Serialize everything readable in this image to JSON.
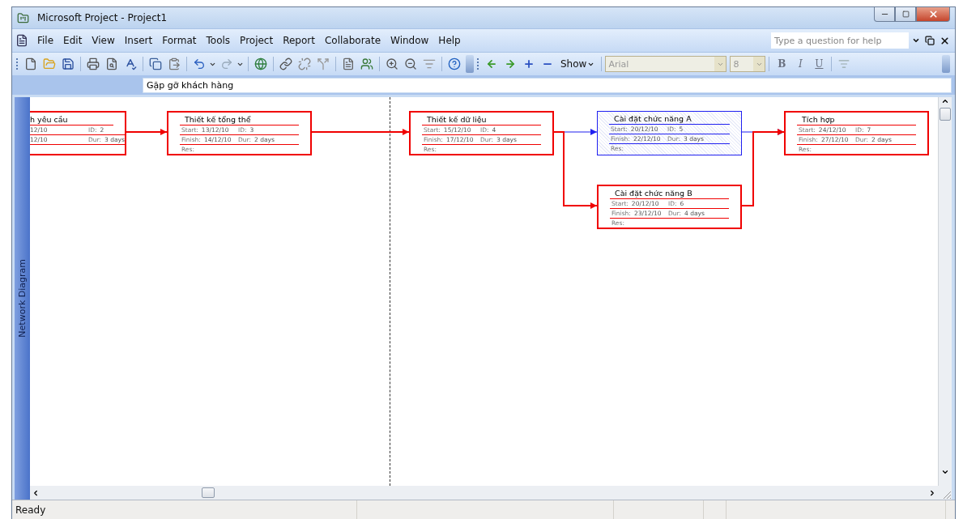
{
  "window": {
    "title": "Microsoft Project - Project1"
  },
  "menu": [
    {
      "label": "File"
    },
    {
      "label": "Edit"
    },
    {
      "label": "View"
    },
    {
      "label": "Insert"
    },
    {
      "label": "Format"
    },
    {
      "label": "Tools"
    },
    {
      "label": "Project"
    },
    {
      "label": "Report"
    },
    {
      "label": "Collaborate"
    },
    {
      "label": "Window"
    },
    {
      "label": "Help"
    }
  ],
  "help_search": {
    "placeholder": "Type a question for help"
  },
  "formatting": {
    "show": "Show",
    "font": "Arial",
    "size": "8",
    "bold": "B",
    "italic": "I",
    "underline": "U"
  },
  "entry_bar": {
    "value": "Gặp gỡ khách hàng"
  },
  "view_bar": {
    "label": "Network Diagram"
  },
  "nodes": [
    {
      "title": "h yêu cầu",
      "selected": false,
      "fields": [
        {
          "value": "12/10"
        },
        {
          "label": "ID:",
          "value": "2"
        },
        {
          "value": "12/10"
        },
        {
          "label": "Dur:",
          "value": "3 days"
        }
      ]
    },
    {
      "title": "Thiết kế tổng thể",
      "selected": false,
      "fields": [
        {
          "label": "Start:",
          "value": "13/12/10"
        },
        {
          "label": "ID:",
          "value": "3"
        },
        {
          "label": "Finish:",
          "value": "14/12/10"
        },
        {
          "label": "Dur:",
          "value": "2 days"
        },
        {
          "label": "Res:"
        }
      ]
    },
    {
      "title": "Thiết kế dữ liệu",
      "selected": false,
      "fields": [
        {
          "label": "Start:",
          "value": "15/12/10"
        },
        {
          "label": "ID:",
          "value": "4"
        },
        {
          "label": "Finish:",
          "value": "17/12/10"
        },
        {
          "label": "Dur:",
          "value": "3 days"
        },
        {
          "label": "Res:"
        }
      ]
    },
    {
      "title": "Cài đặt chức năng A",
      "selected": true,
      "fields": [
        {
          "label": "Start:",
          "value": "20/12/10"
        },
        {
          "label": "ID:",
          "value": "5"
        },
        {
          "label": "Finish:",
          "value": "22/12/10"
        },
        {
          "label": "Dur:",
          "value": "3 days"
        },
        {
          "label": "Res:"
        }
      ]
    },
    {
      "title": "Cài đặt chức năng B",
      "selected": false,
      "fields": [
        {
          "label": "Start:",
          "value": "20/12/10"
        },
        {
          "label": "ID:",
          "value": "6"
        },
        {
          "label": "Finish:",
          "value": "23/12/10"
        },
        {
          "label": "Dur:",
          "value": "4 days"
        },
        {
          "label": "Res:"
        }
      ]
    },
    {
      "title": "Tích hợp",
      "selected": false,
      "fields": [
        {
          "label": "Start:",
          "value": "24/12/10"
        },
        {
          "label": "ID:",
          "value": "7"
        },
        {
          "label": "Finish:",
          "value": "27/12/10"
        },
        {
          "label": "Dur:",
          "value": "2 days"
        },
        {
          "label": "Res:"
        }
      ]
    }
  ],
  "status_bar": {
    "text": "Ready"
  }
}
